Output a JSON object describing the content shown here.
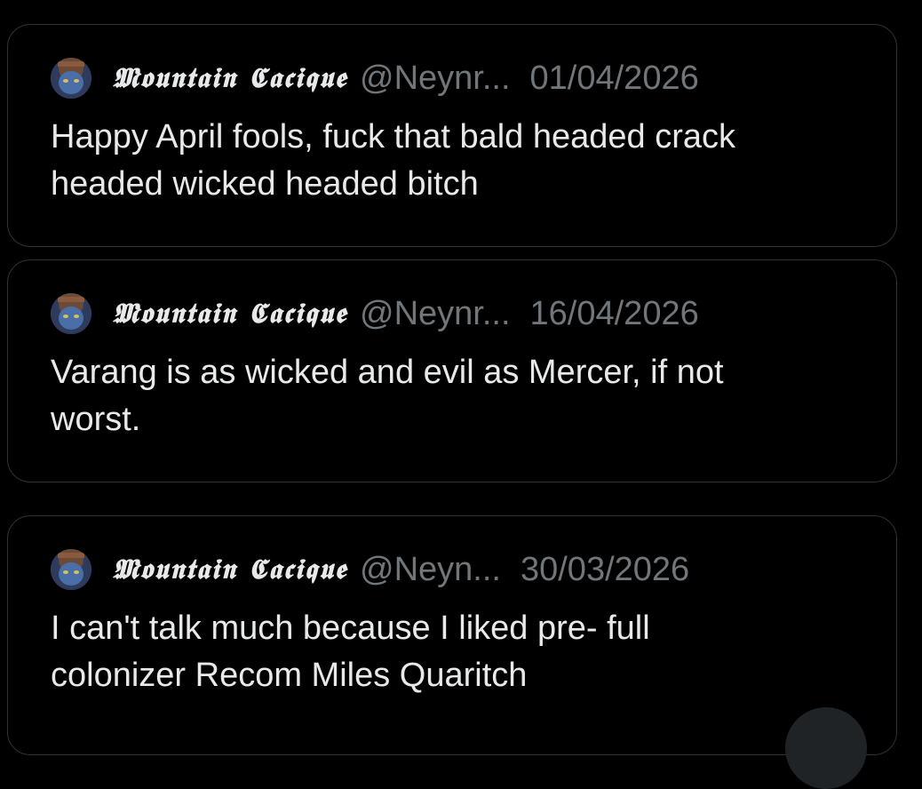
{
  "posts": [
    {
      "author": "𝕸𝖔𝖚𝖓𝖙𝖆𝖎𝖓 𝕮𝖆𝖈𝖎𝖖𝖚𝖊",
      "handle": "@Neynr...",
      "date": "01/04/2026",
      "text": "Happy April fools, fuck that bald headed crack\nheaded wicked headed bitch"
    },
    {
      "author": "𝕸𝖔𝖚𝖓𝖙𝖆𝖎𝖓 𝕮𝖆𝖈𝖎𝖖𝖚𝖊",
      "handle": "@Neynr...",
      "date": "16/04/2026",
      "text": "Varang is as wicked and evil as Mercer, if not\nworst."
    },
    {
      "author": "𝕸𝖔𝖚𝖓𝖙𝖆𝖎𝖓 𝕮𝖆𝖈𝖎𝖖𝖚𝖊",
      "handle": "@Neyn...",
      "date": "30/03/2026",
      "text": "I can't talk much because I liked pre- full\ncolonizer Recom Miles Quaritch"
    }
  ],
  "colors": {
    "background": "#000000",
    "card_border": "#2f3336",
    "primary_text": "#e7e9ea",
    "secondary_text": "#71767b"
  },
  "icons": {
    "avatar": "avatar-icon",
    "floating_button": "floating-action-button"
  }
}
